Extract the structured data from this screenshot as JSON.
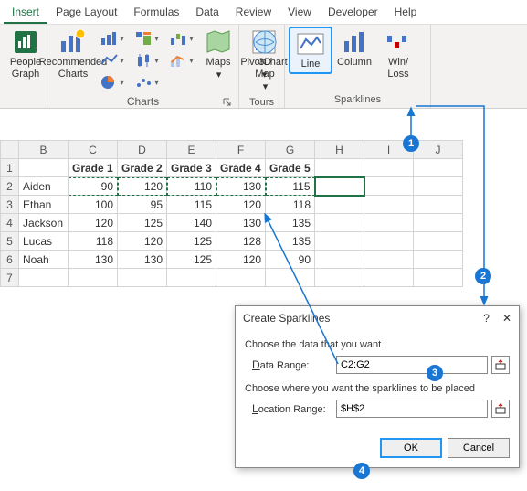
{
  "tabs": {
    "insert": "Insert",
    "pageLayout": "Page Layout",
    "formulas": "Formulas",
    "data": "Data",
    "review": "Review",
    "view": "View",
    "developer": "Developer",
    "help": "Help"
  },
  "ribbon": {
    "peopleGraph": "People\nGraph",
    "recCharts": "Recommended\nCharts",
    "maps": "Maps",
    "pivotChart": "PivotChart",
    "map3d": "3D\nMap",
    "line": "Line",
    "column": "Column",
    "winloss": "Win/\nLoss",
    "groups": {
      "charts": "Charts",
      "tours": "Tours",
      "sparklines": "Sparklines"
    }
  },
  "columns": [
    "B",
    "C",
    "D",
    "E",
    "F",
    "G",
    "H",
    "I",
    "J"
  ],
  "headers": {
    "g1": "Grade 1",
    "g2": "Grade 2",
    "g3": "Grade 3",
    "g4": "Grade 4",
    "g5": "Grade 5"
  },
  "rows": [
    {
      "name": "Aiden",
      "v": [
        "90",
        "120",
        "110",
        "130",
        "115"
      ]
    },
    {
      "name": "Ethan",
      "v": [
        "100",
        "95",
        "115",
        "120",
        "118"
      ]
    },
    {
      "name": "Jackson",
      "v": [
        "120",
        "125",
        "140",
        "130",
        "135"
      ]
    },
    {
      "name": "Lucas",
      "v": [
        "118",
        "120",
        "125",
        "128",
        "135"
      ]
    },
    {
      "name": "Noah",
      "v": [
        "130",
        "130",
        "125",
        "120",
        "90"
      ]
    }
  ],
  "dialog": {
    "title": "Create Sparklines",
    "sec1": "Choose the data that you want",
    "dataRange": "Data Range:",
    "dataRangeU": "D",
    "dataRangeVal": "C2:G2",
    "sec2": "Choose where you want the sparklines to be placed",
    "locRange": "Location Range:",
    "locRangeU": "L",
    "locRangeVal": "$H$2",
    "ok": "OK",
    "cancel": "Cancel",
    "help": "?",
    "close": "✕"
  },
  "callouts": {
    "c1": "1",
    "c2": "2",
    "c3": "3",
    "c4": "4"
  }
}
